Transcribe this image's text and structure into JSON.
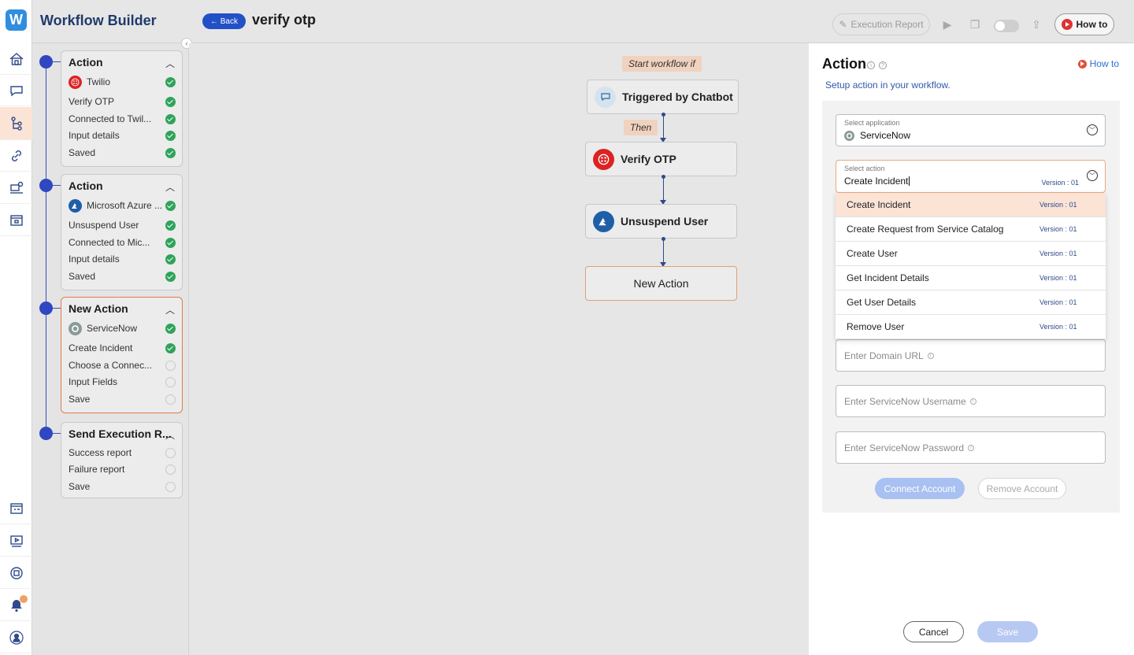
{
  "app": {
    "logo_letter": "W",
    "title": "Workflow Builder"
  },
  "header": {
    "back_label": "← Back",
    "workflow_name": "verify otp",
    "execution_report_label": "Execution Report",
    "how_to_label": "How to"
  },
  "steps": [
    {
      "title": "Action",
      "app": "Twilio",
      "items": [
        "Verify OTP",
        "Connected to Twil...",
        "Input details",
        "Saved"
      ]
    },
    {
      "title": "Action",
      "app": "Microsoft Azure ...",
      "items": [
        "Unsuspend User",
        "Connected to Mic...",
        "Input details",
        "Saved"
      ]
    },
    {
      "title": "New Action",
      "app": "ServiceNow",
      "items": [
        "Create Incident",
        "Choose a Connec...",
        "Input Fields",
        "Save"
      ]
    },
    {
      "title": "Send Execution R...",
      "items": [
        "Success report",
        "Failure report",
        "Save"
      ]
    }
  ],
  "canvas": {
    "start_tag": "Start workflow if",
    "trigger_node": "Triggered by Chatbot",
    "then_tag": "Then",
    "node_1": "Verify OTP",
    "node_2": "Unsuspend User",
    "new_action": "New Action"
  },
  "panel": {
    "title": "Action",
    "how_to": "How to",
    "subtitle": "Setup action in your workflow.",
    "select_application_label": "Select application",
    "select_application_value": "ServiceNow",
    "select_action_label": "Select action",
    "select_action_value": "Create Incident",
    "select_action_version": "Version : 01",
    "options": [
      {
        "label": "Create Incident",
        "version": "Version : 01"
      },
      {
        "label": "Create Request from Service Catalog",
        "version": "Version : 01"
      },
      {
        "label": "Create User",
        "version": "Version : 01"
      },
      {
        "label": "Get Incident Details",
        "version": "Version : 01"
      },
      {
        "label": "Get User Details",
        "version": "Version : 01"
      },
      {
        "label": "Remove User",
        "version": "Version : 01"
      }
    ],
    "domain_url_placeholder": "Enter Domain URL",
    "username_placeholder": "Enter ServiceNow Username",
    "password_placeholder": "Enter ServiceNow Password",
    "connect_label": "Connect Account",
    "remove_label": "Remove Account",
    "cancel_label": "Cancel",
    "save_label": "Save"
  },
  "colors": {
    "primary": "#2350c7",
    "accent": "#e07b4a",
    "success": "#2fa35b"
  }
}
